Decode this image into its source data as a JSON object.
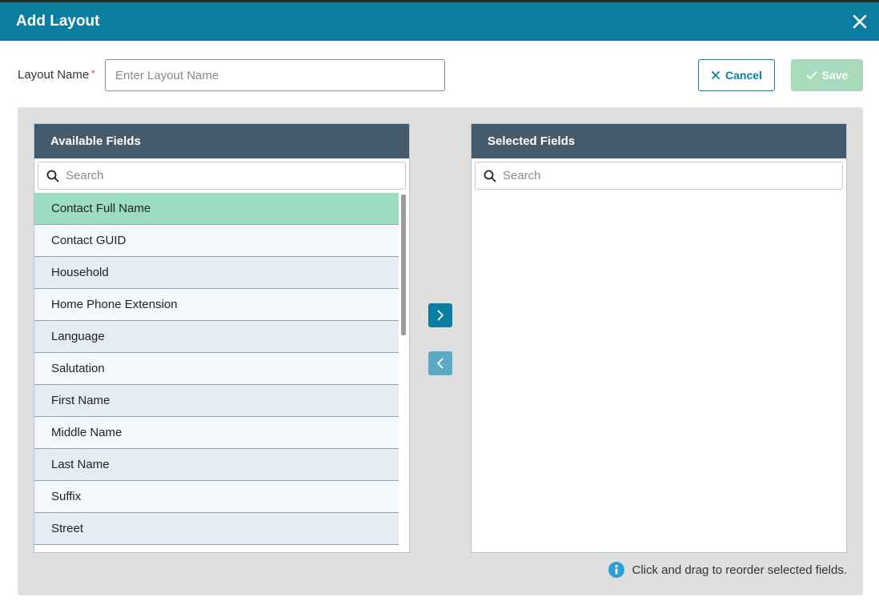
{
  "dialog": {
    "title": "Add Layout"
  },
  "form": {
    "layout_name_label": "Layout Name",
    "required_marker": "*",
    "layout_name_placeholder": "Enter Layout Name",
    "layout_name_value": ""
  },
  "actions": {
    "cancel_label": "Cancel",
    "save_label": "Save",
    "save_enabled": false
  },
  "available": {
    "header": "Available Fields",
    "search_placeholder": "Search",
    "items": [
      {
        "label": "Contact Full Name",
        "selected": true
      },
      {
        "label": "Contact GUID",
        "selected": false
      },
      {
        "label": "Household",
        "selected": false
      },
      {
        "label": "Home Phone Extension",
        "selected": false
      },
      {
        "label": "Language",
        "selected": false
      },
      {
        "label": "Salutation",
        "selected": false
      },
      {
        "label": "First Name",
        "selected": false
      },
      {
        "label": "Middle Name",
        "selected": false
      },
      {
        "label": "Last Name",
        "selected": false
      },
      {
        "label": "Suffix",
        "selected": false
      },
      {
        "label": "Street",
        "selected": false
      }
    ]
  },
  "selected": {
    "header": "Selected Fields",
    "search_placeholder": "Search",
    "items": []
  },
  "transfer": {
    "add_icon": "chevron-right-icon",
    "remove_icon": "chevron-left-icon"
  },
  "hint": {
    "icon": "info-icon",
    "text": "Click and drag to reorder selected fields."
  },
  "colors": {
    "titlebar": "#0a7ea1",
    "panel_header": "#455a6b",
    "selected_row": "#9cdcc2",
    "save_disabled": "#a7dbbb",
    "info_icon": "#2a9fd8"
  }
}
